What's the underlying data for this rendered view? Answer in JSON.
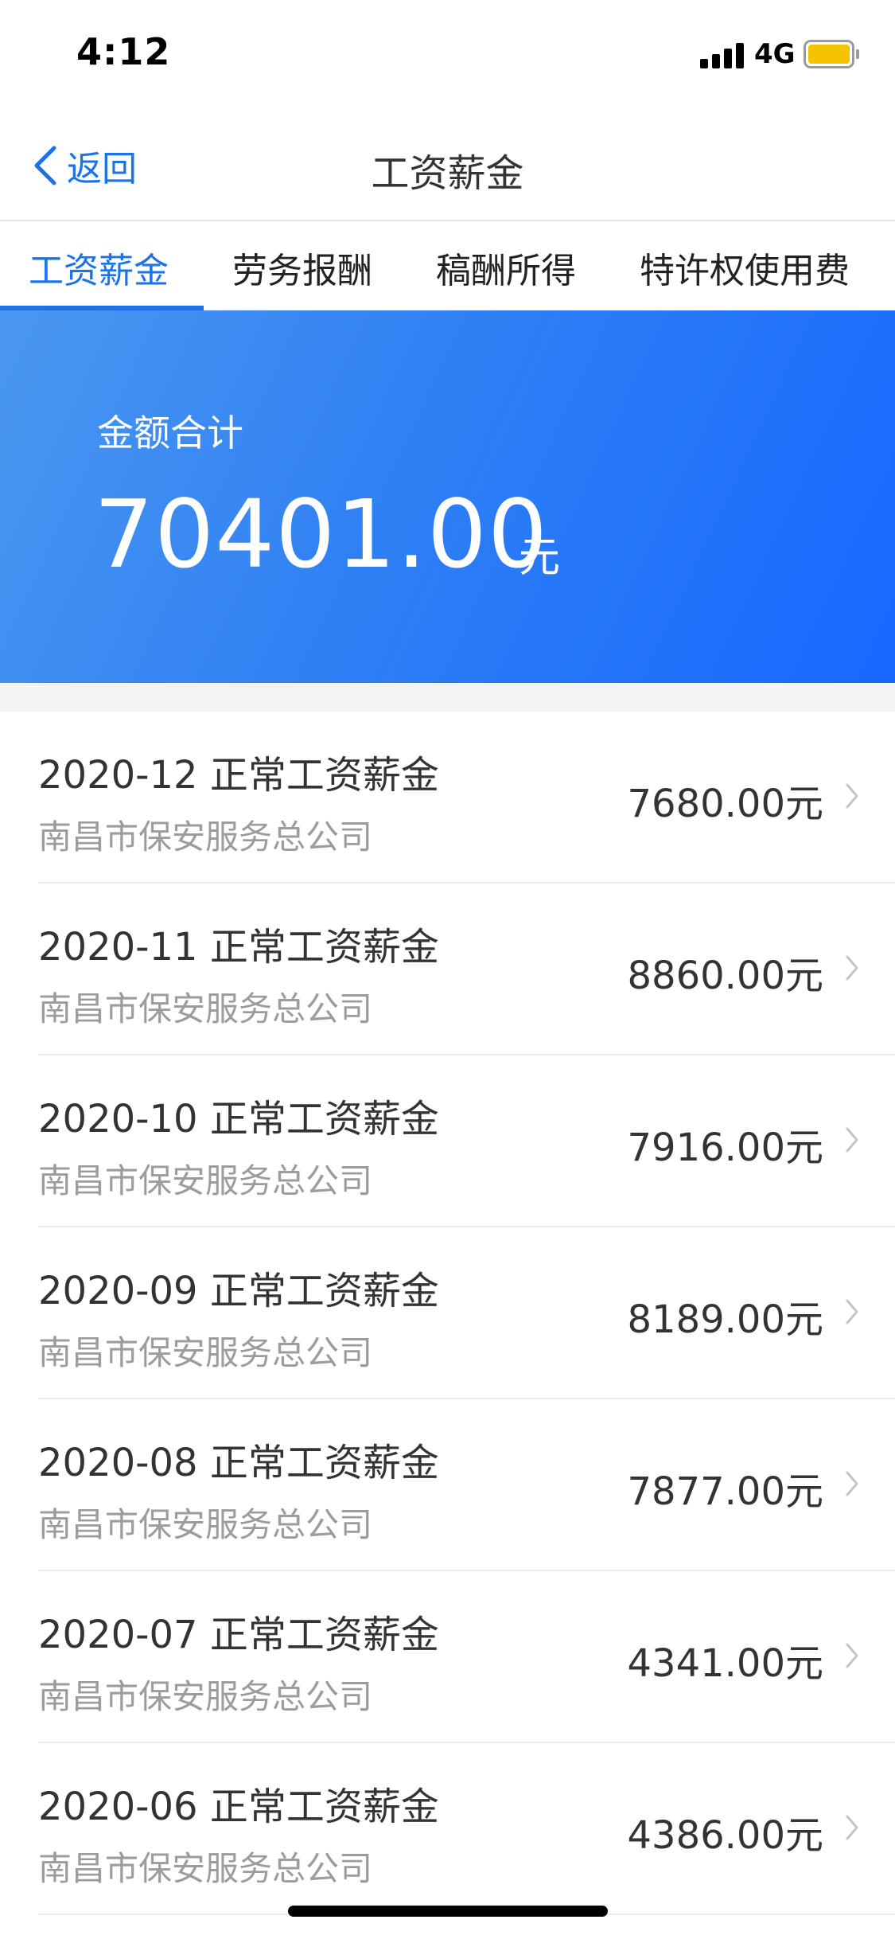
{
  "status_bar": {
    "time": "4:12",
    "network": "4G",
    "battery_color": "#f5c400"
  },
  "nav": {
    "back_label": "返回",
    "title": "工资薪金"
  },
  "tabs": [
    {
      "label": "工资薪金",
      "active": true
    },
    {
      "label": "劳务报酬",
      "active": false
    },
    {
      "label": "稿酬所得",
      "active": false
    },
    {
      "label": "特许权使用费",
      "active": false
    }
  ],
  "summary": {
    "label": "金额合计",
    "amount": "70401.00",
    "unit": "元"
  },
  "records": [
    {
      "title": "2020-12 正常工资薪金",
      "company": "南昌市保安服务总公司",
      "amount": "7680.00元"
    },
    {
      "title": "2020-11 正常工资薪金",
      "company": "南昌市保安服务总公司",
      "amount": "8860.00元"
    },
    {
      "title": "2020-10 正常工资薪金",
      "company": "南昌市保安服务总公司",
      "amount": "7916.00元"
    },
    {
      "title": "2020-09 正常工资薪金",
      "company": "南昌市保安服务总公司",
      "amount": "8189.00元"
    },
    {
      "title": "2020-08 正常工资薪金",
      "company": "南昌市保安服务总公司",
      "amount": "7877.00元"
    },
    {
      "title": "2020-07 正常工资薪金",
      "company": "南昌市保安服务总公司",
      "amount": "4341.00元"
    },
    {
      "title": "2020-06 正常工资薪金",
      "company": "南昌市保安服务总公司",
      "amount": "4386.00元"
    }
  ],
  "colors": {
    "accent": "#1a73e8",
    "hero_start": "#4b97f0",
    "hero_end": "#1768ff"
  }
}
